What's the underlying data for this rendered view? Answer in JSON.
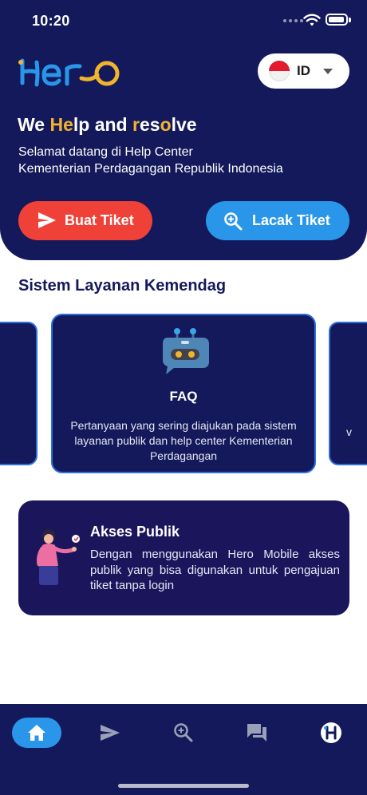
{
  "status_bar": {
    "time": "10:20"
  },
  "header": {
    "logo_text": "Hero",
    "language": {
      "code": "ID",
      "flag": "indonesia"
    },
    "tagline": {
      "p1": "We ",
      "p2": "He",
      "p3": "lp and ",
      "p4": "r",
      "p5": "es",
      "p6": "o",
      "p7": "lve"
    },
    "welcome_line1": "Selamat datang di Help Center",
    "welcome_line2": "Kementerian Perdagangan Republik Indonesia",
    "buttons": {
      "create": "Buat Tiket",
      "track": "Lacak Tiket"
    }
  },
  "services": {
    "title": "Sistem Layanan Kemendag",
    "card": {
      "title": "FAQ",
      "description": "Pertanyaan yang sering diajukan pada sistem layanan publik dan help center Kementerian Perdagangan"
    },
    "right_peek_text": "v"
  },
  "public_access": {
    "title": "Akses Publik",
    "description": "Dengan menggunakan Hero Mobile akses publik yang bisa digunakan untuk pengajuan tiket tanpa login"
  },
  "bottom_nav": {
    "items": [
      {
        "icon": "home-icon",
        "active": true
      },
      {
        "icon": "send-icon",
        "active": false
      },
      {
        "icon": "zoom-search-icon",
        "active": false
      },
      {
        "icon": "chat-icon",
        "active": false
      },
      {
        "icon": "hero-profile-icon",
        "active": false
      }
    ]
  },
  "colors": {
    "navy": "#13195a",
    "accent_yellow": "#f1b42f",
    "red": "#f04138",
    "blue": "#2a96ea",
    "card_border": "#2e6fe0"
  }
}
